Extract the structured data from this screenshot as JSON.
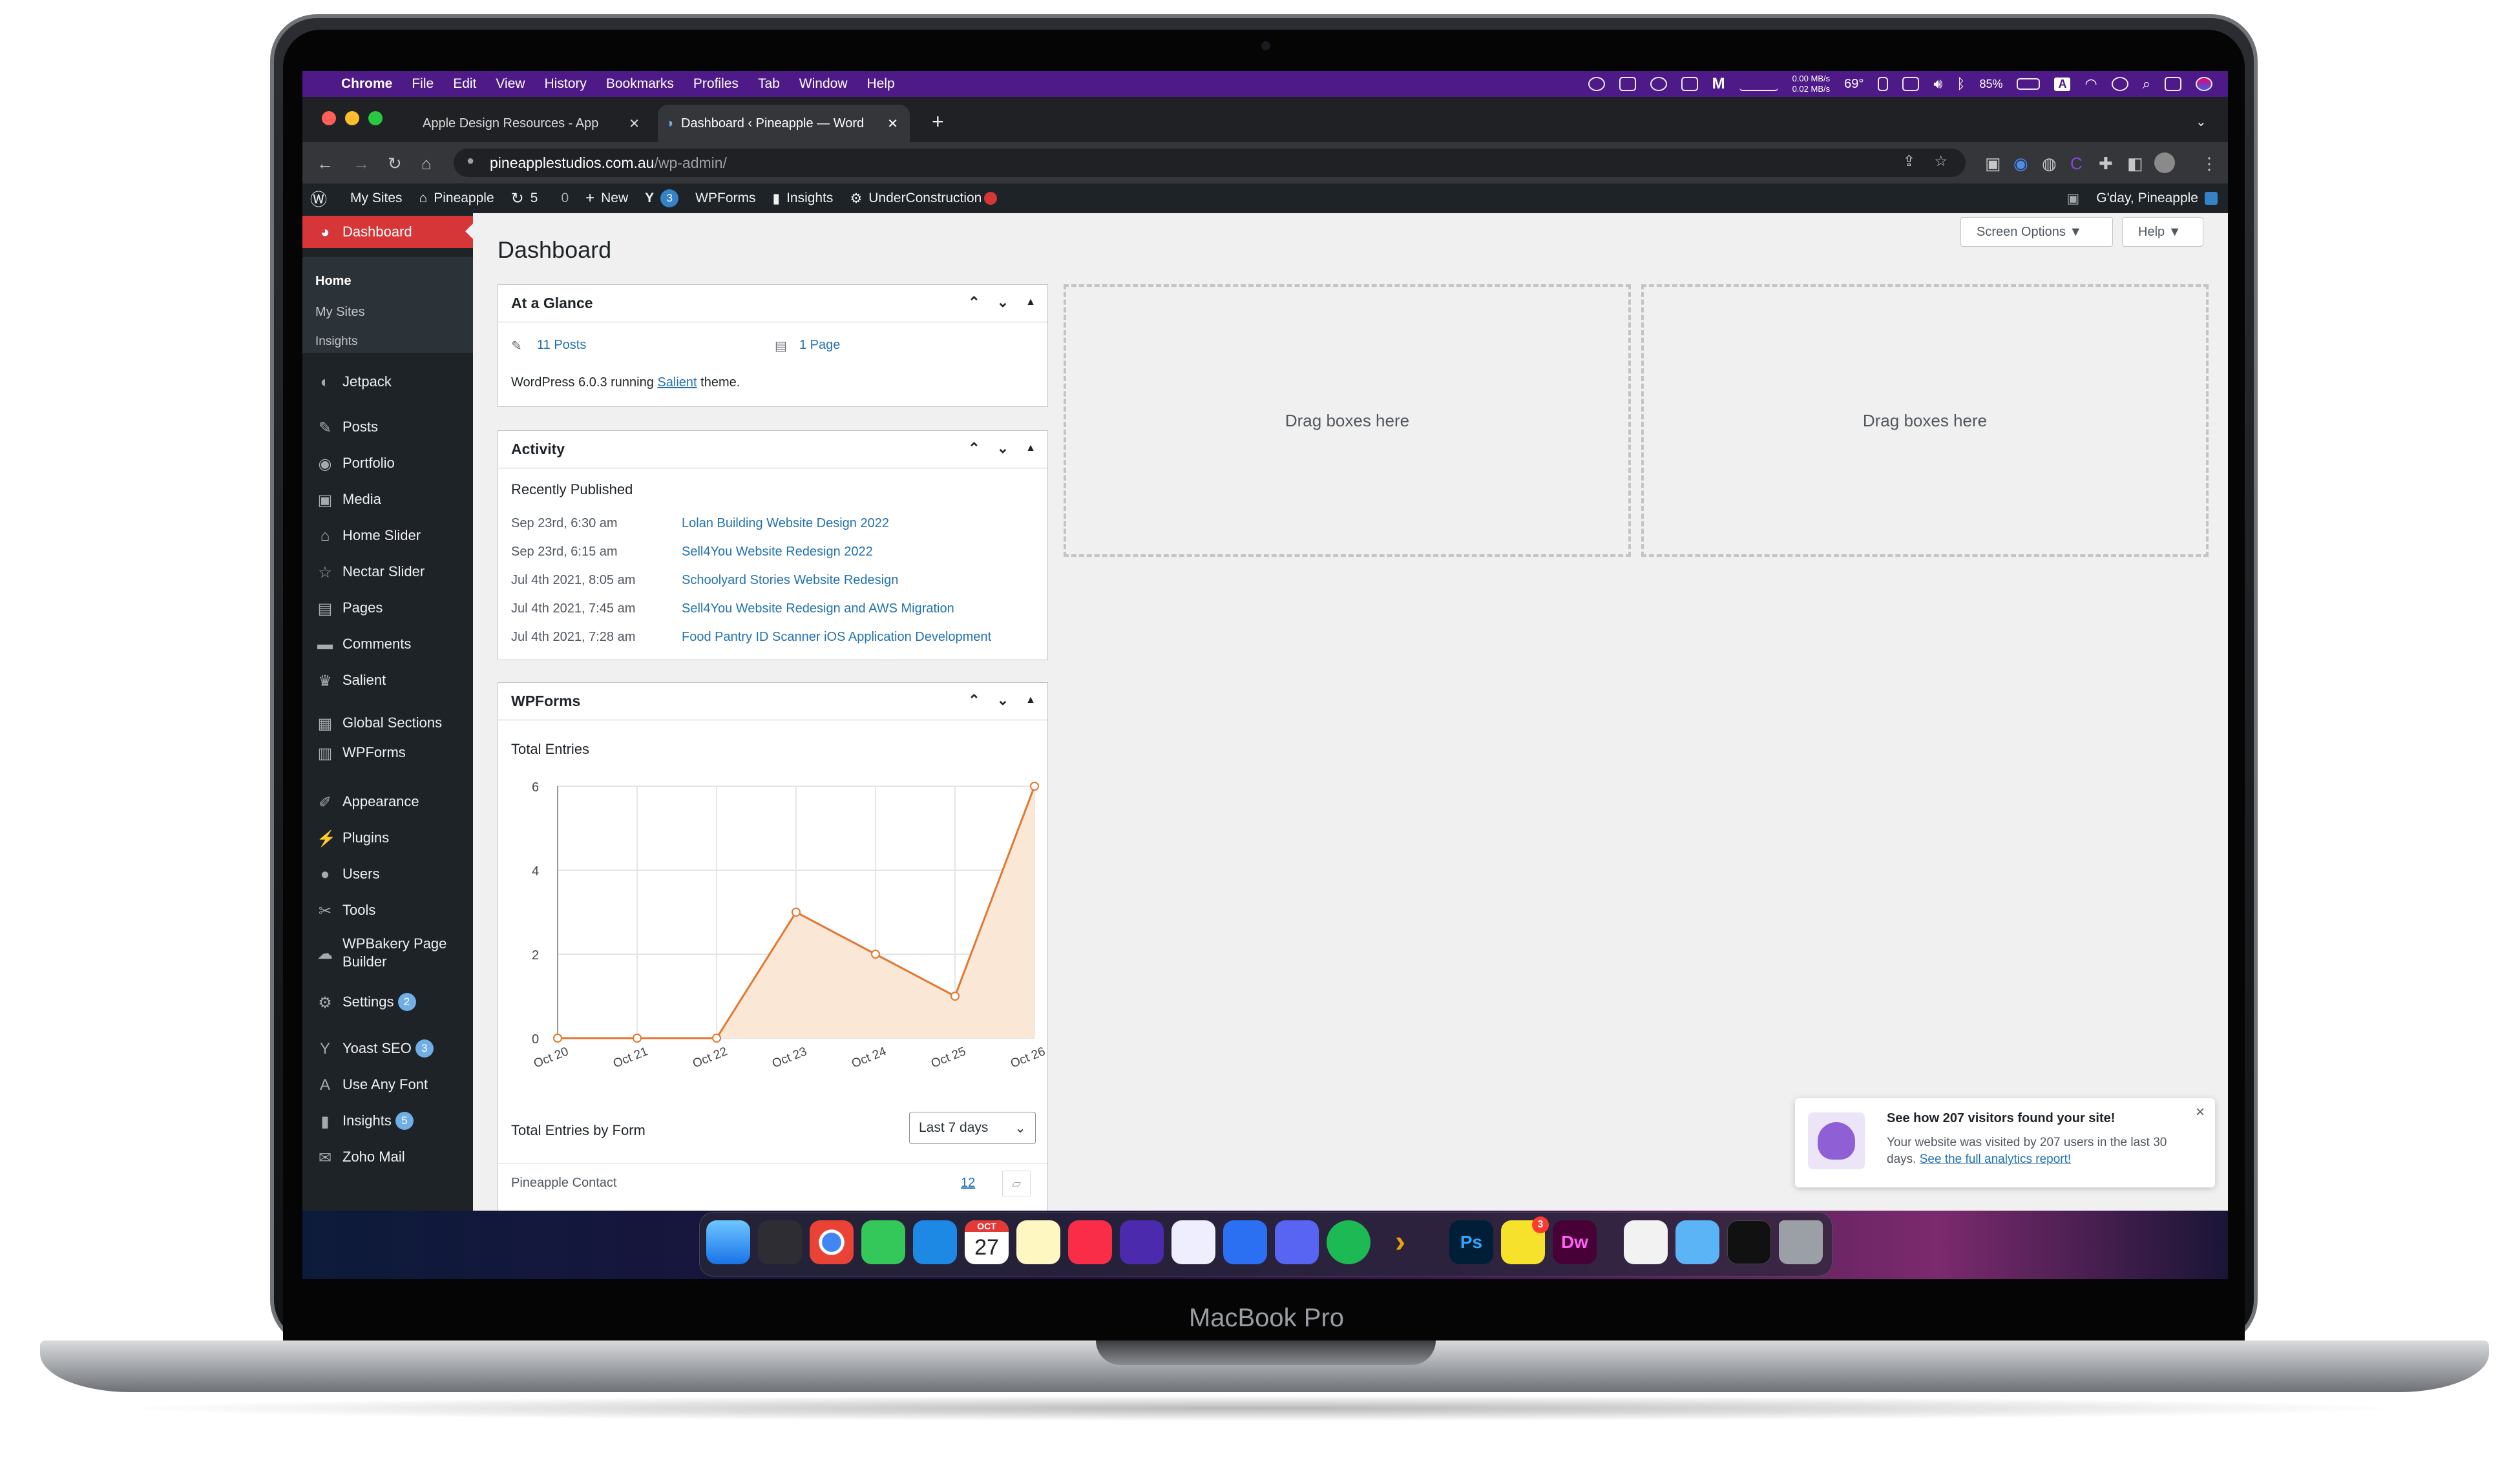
{
  "device": {
    "label": "MacBook Pro"
  },
  "menubar": {
    "app": "Chrome",
    "items": [
      "File",
      "Edit",
      "View",
      "History",
      "Bookmarks",
      "Profiles",
      "Tab",
      "Window",
      "Help"
    ],
    "net_up": "0.00 MB/s",
    "net_down": "0.02 MB/s",
    "temperature": "69°",
    "battery": "85%",
    "input_source": "A"
  },
  "browser": {
    "tabs": [
      {
        "title": "Apple Design Resources - App"
      },
      {
        "title": "Dashboard ‹ Pineapple — Word"
      }
    ],
    "new_tab": "+",
    "url_host": "pineapplestudios.com.au",
    "url_path": "/wp-admin/"
  },
  "adminbar": {
    "my_sites": "My Sites",
    "site": "Pineapple",
    "updates": "5",
    "comments": "0",
    "new": "New",
    "yoast_count": "3",
    "wpforms": "WPForms",
    "insights": "Insights",
    "under_construction": "UnderConstruction",
    "greeting": "G'day, Pineapple"
  },
  "sidebar": {
    "dashboard": "Dashboard",
    "sub": [
      "Home",
      "My Sites",
      "Insights"
    ],
    "items": [
      {
        "label": "Jetpack",
        "icon": "jetpack-icon",
        "sym": "◐"
      },
      {
        "label": "Posts",
        "icon": "pin-icon",
        "sym": "✎"
      },
      {
        "label": "Portfolio",
        "icon": "palette-icon",
        "sym": "◉"
      },
      {
        "label": "Media",
        "icon": "media-icon",
        "sym": "▣"
      },
      {
        "label": "Home Slider",
        "icon": "home-icon",
        "sym": "⌂"
      },
      {
        "label": "Nectar Slider",
        "icon": "star-icon",
        "sym": "☆"
      },
      {
        "label": "Pages",
        "icon": "pages-icon",
        "sym": "▤"
      },
      {
        "label": "Comments",
        "icon": "comment-icon",
        "sym": "▬"
      },
      {
        "label": "Salient",
        "icon": "crown-icon",
        "sym": "♛"
      },
      {
        "label": "Global Sections",
        "icon": "grid-icon",
        "sym": "▦"
      },
      {
        "label": "WPForms",
        "icon": "form-icon",
        "sym": "▥"
      },
      {
        "label": "Appearance",
        "icon": "brush-icon",
        "sym": "✐"
      },
      {
        "label": "Plugins",
        "icon": "plug-icon",
        "sym": "⚡"
      },
      {
        "label": "Users",
        "icon": "user-icon",
        "sym": "●"
      },
      {
        "label": "Tools",
        "icon": "wrench-icon",
        "sym": "✂"
      },
      {
        "label": "WPBakery Page Builder",
        "icon": "cloud-icon",
        "sym": "☁"
      },
      {
        "label": "Settings",
        "icon": "settings-icon",
        "sym": "⚙",
        "badge": "2"
      },
      {
        "label": "Yoast SEO",
        "icon": "yoast-icon",
        "sym": "Y",
        "badge": "3"
      },
      {
        "label": "Use Any Font",
        "icon": "font-icon",
        "sym": "A"
      },
      {
        "label": "Insights",
        "icon": "insights-icon",
        "sym": "▮",
        "badge": "5"
      },
      {
        "label": "Zoho Mail",
        "icon": "mail-icon",
        "sym": "✉"
      }
    ]
  },
  "dashboard": {
    "title": "Dashboard",
    "screen_options": "Screen Options ▼",
    "help": "Help ▼",
    "glance": {
      "title": "At a Glance",
      "posts": "11 Posts",
      "pages": "1 Page",
      "running_prefix": "WordPress 6.0.3 running ",
      "theme": "Salient",
      "running_suffix": " theme."
    },
    "activity": {
      "title": "Activity",
      "subtitle": "Recently Published",
      "rows": [
        {
          "date": "Sep 23rd, 6:30 am",
          "title": "Lolan Building Website Design 2022"
        },
        {
          "date": "Sep 23rd, 6:15 am",
          "title": "Sell4You Website Redesign 2022"
        },
        {
          "date": "Jul 4th 2021, 8:05 am",
          "title": "Schoolyard Stories Website Redesign"
        },
        {
          "date": "Jul 4th 2021, 7:45 am",
          "title": "Sell4You Website Redesign and AWS Migration"
        },
        {
          "date": "Jul 4th 2021, 7:28 am",
          "title": "Food Pantry ID Scanner iOS Application Development"
        }
      ]
    },
    "wpforms": {
      "title": "WPForms",
      "total_entries": "Total Entries",
      "by_form": "Total Entries by Form",
      "range": "Last 7 days",
      "form_name": "Pineapple Contact",
      "form_count": "12"
    },
    "drag_text": "Drag boxes here"
  },
  "chart_data": {
    "type": "area",
    "title": "Total Entries",
    "x": [
      "Oct 20",
      "Oct 21",
      "Oct 22",
      "Oct 23",
      "Oct 24",
      "Oct 25",
      "Oct 26"
    ],
    "values": [
      0,
      0,
      0,
      3,
      2,
      1,
      6
    ],
    "ylim": [
      0,
      6
    ],
    "yticks": [
      0,
      2,
      4,
      6
    ],
    "line_color": "#e27730",
    "fill_color": "#fbe7d6",
    "grid": true
  },
  "notice": {
    "title": "See how 207 visitors found your site!",
    "body": "Your website was visited by 207 users in the last 30 days. ",
    "link": "See the full analytics report!",
    "close": "×"
  },
  "dock": {
    "calendar_month": "OCT",
    "calendar_day": "27",
    "ps": "Ps",
    "dw": "Dw",
    "badge": "3"
  },
  "colors": {
    "wp_red": "#d63638",
    "wp_dark": "#1d2327",
    "link": "#2271b1",
    "menubar": "#4e1a87"
  }
}
